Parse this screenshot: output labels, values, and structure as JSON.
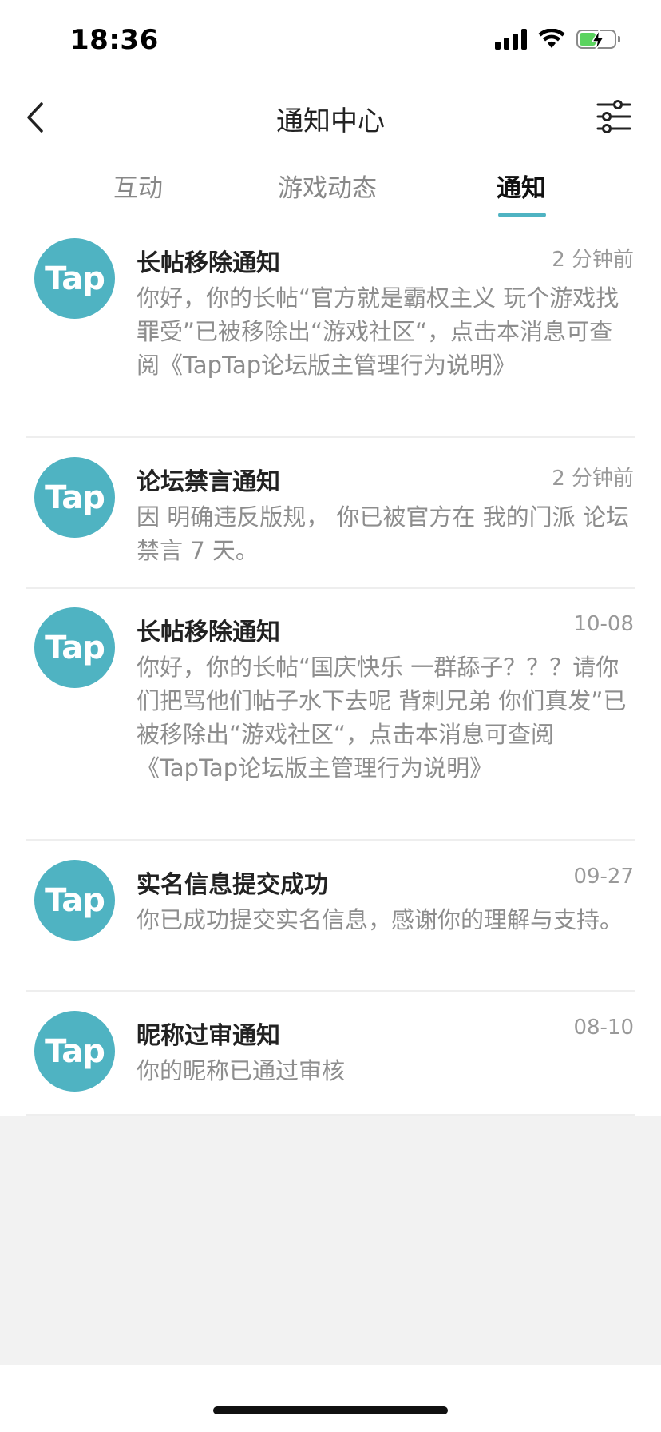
{
  "status": {
    "time": "18:36"
  },
  "nav": {
    "title": "通知中心"
  },
  "tabs": [
    {
      "label": "互动"
    },
    {
      "label": "游戏动态"
    },
    {
      "label": "通知"
    }
  ],
  "avatar_text": "Tap",
  "colors": {
    "accent": "#4fb3c2",
    "battery": "#5bd35f"
  },
  "notifications": [
    {
      "title": "长帖移除通知",
      "time": "2 分钟前",
      "body": "你好，你的长帖“官方就是霸权主义 玩个游戏找罪受”已被移除出“游戏社区“，点击本消息可查阅《TapTap论坛版主管理行为说明》"
    },
    {
      "title": "论坛禁言通知",
      "time": "2 分钟前",
      "body": "因 明确违反版规， 你已被官方在 我的门派 论坛禁言 7 天。"
    },
    {
      "title": "长帖移除通知",
      "time": "10-08",
      "body": "你好，你的长帖“国庆快乐 一群舔子？？？请你们把骂他们帖子水下去呢 背刺兄弟 你们真发”已被移除出“游戏社区“，点击本消息可查阅《TapTap论坛版主管理行为说明》"
    },
    {
      "title": "实名信息提交成功",
      "time": "09-27",
      "body": "你已成功提交实名信息，感谢你的理解与支持。"
    },
    {
      "title": "昵称过审通知",
      "time": "08-10",
      "body": "你的昵称已通过审核"
    }
  ]
}
